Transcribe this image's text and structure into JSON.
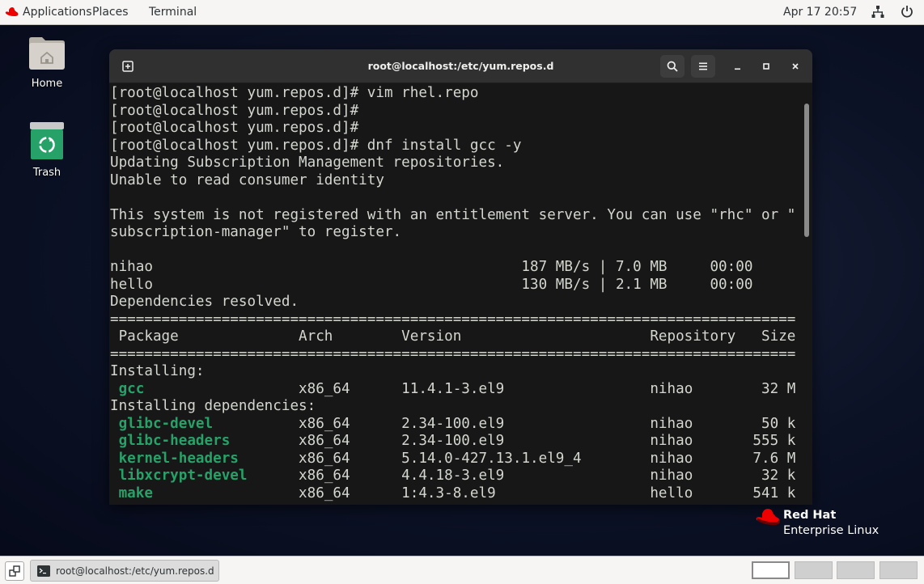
{
  "topbar": {
    "applications": "Applications",
    "places": "Places",
    "terminal": "Terminal",
    "clock": "Apr 17  20:57"
  },
  "desktop": {
    "home_label": "Home",
    "trash_label": "Trash"
  },
  "window": {
    "title": "root@localhost:/etc/yum.repos.d"
  },
  "terminal": {
    "lines": [
      "[root@localhost yum.repos.d]# vim rhel.repo",
      "[root@localhost yum.repos.d]#",
      "[root@localhost yum.repos.d]#",
      "[root@localhost yum.repos.d]# dnf install gcc -y",
      "Updating Subscription Management repositories.",
      "Unable to read consumer identity",
      "",
      "This system is not registered with an entitlement server. You can use \"rhc\" or \"",
      "subscription-manager\" to register.",
      "",
      "nihao                                           187 MB/s | 7.0 MB     00:00",
      "hello                                           130 MB/s | 2.1 MB     00:00",
      "Dependencies resolved.",
      "================================================================================",
      " Package              Arch        Version                      Repository   Size",
      "================================================================================",
      "Installing:",
      "",
      "Installing dependencies:",
      "",
      "",
      "",
      "",
      ""
    ],
    "packages": [
      {
        "line": 17,
        "name": "gcc",
        "rest": "                  x86_64      11.4.1-3.el9                 nihao        32 M"
      },
      {
        "line": 19,
        "name": "glibc-devel",
        "rest": "          x86_64      2.34-100.el9                 nihao        50 k"
      },
      {
        "line": 20,
        "name": "glibc-headers",
        "rest": "        x86_64      2.34-100.el9                 nihao       555 k"
      },
      {
        "line": 21,
        "name": "kernel-headers",
        "rest": "       x86_64      5.14.0-427.13.1.el9_4        nihao       7.6 M"
      },
      {
        "line": 22,
        "name": "libxcrypt-devel",
        "rest": "      x86_64      4.4.18-3.el9                 nihao        32 k"
      },
      {
        "line": 23,
        "name": "make",
        "rest": "                 x86_64      1:4.3-8.el9                  hello       541 k"
      }
    ]
  },
  "branding": {
    "line1": "Red Hat",
    "line2": "Enterprise Linux"
  },
  "taskbar": {
    "task_title": "root@localhost:/etc/yum.repos.d"
  },
  "colors": {
    "package_green": "#26a269",
    "terminal_bg": "#171717",
    "text": "#d3d7cf",
    "redhat_red": "#ee0000"
  }
}
